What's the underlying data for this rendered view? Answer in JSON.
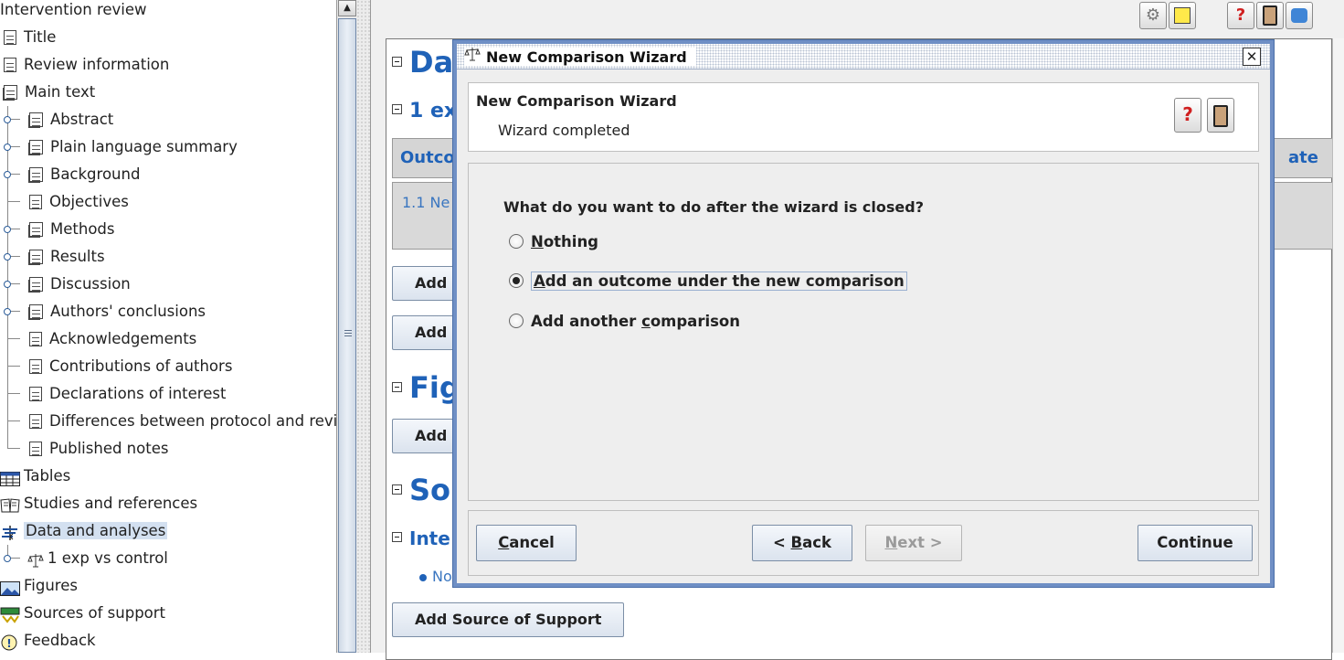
{
  "tree": {
    "root_label": "Intervention review",
    "items": [
      {
        "label": "Title"
      },
      {
        "label": "Review information"
      },
      {
        "label": "Main text"
      },
      {
        "label": "Abstract"
      },
      {
        "label": "Plain language summary"
      },
      {
        "label": "Background"
      },
      {
        "label": "Objectives"
      },
      {
        "label": "Methods"
      },
      {
        "label": "Results"
      },
      {
        "label": "Discussion"
      },
      {
        "label": "Authors' conclusions"
      },
      {
        "label": "Acknowledgements"
      },
      {
        "label": "Contributions of authors"
      },
      {
        "label": "Declarations of interest"
      },
      {
        "label": "Differences between protocol and revi"
      },
      {
        "label": "Published notes"
      },
      {
        "label": "Tables"
      },
      {
        "label": "Studies and references"
      },
      {
        "label": "Data and analyses"
      },
      {
        "label": "1 exp vs control"
      },
      {
        "label": "Figures"
      },
      {
        "label": "Sources of support"
      },
      {
        "label": "Feedback"
      }
    ],
    "selected": "Data and analyses"
  },
  "toolbar": {
    "icons": [
      "wizard-icon",
      "note-icon",
      "help-icon",
      "book-icon",
      "info-icon"
    ]
  },
  "document": {
    "sections": {
      "data": "Da",
      "comparison": "1 ex",
      "figures": "Fig",
      "sources": "So",
      "internal": "Inte"
    },
    "table_header_left": "Outco",
    "table_header_right": "ate",
    "table_row": "1.1 Ne",
    "add_btn_1": "Add (",
    "add_btn_2": "Add (",
    "add_btn_3": "Add F",
    "bullet_text": "No",
    "add_source_button": "Add Source of Support"
  },
  "dialog": {
    "title": "New Comparison Wizard",
    "header_title": "New Comparison Wizard",
    "header_subtitle": "Wizard completed",
    "question": "What do you want to do after the wizard is closed?",
    "options": [
      {
        "pre": "",
        "mnemonic": "N",
        "post": "othing",
        "selected": false
      },
      {
        "pre": "",
        "mnemonic": "A",
        "post": "dd an outcome under the new comparison",
        "selected": true
      },
      {
        "pre": "Add another ",
        "mnemonic": "c",
        "post": "omparison",
        "selected": false
      }
    ],
    "buttons": {
      "cancel_pre": "",
      "cancel_mn": "C",
      "cancel_post": "ancel",
      "back_pre": "< ",
      "back_mn": "B",
      "back_post": "ack",
      "next_pre": "",
      "next_mn": "N",
      "next_post": "ext >",
      "continue": "Continue"
    }
  },
  "colors": {
    "accent": "#1f62b8",
    "dialog_border": "#6f8fc5",
    "selection": "#d3e0f0"
  }
}
